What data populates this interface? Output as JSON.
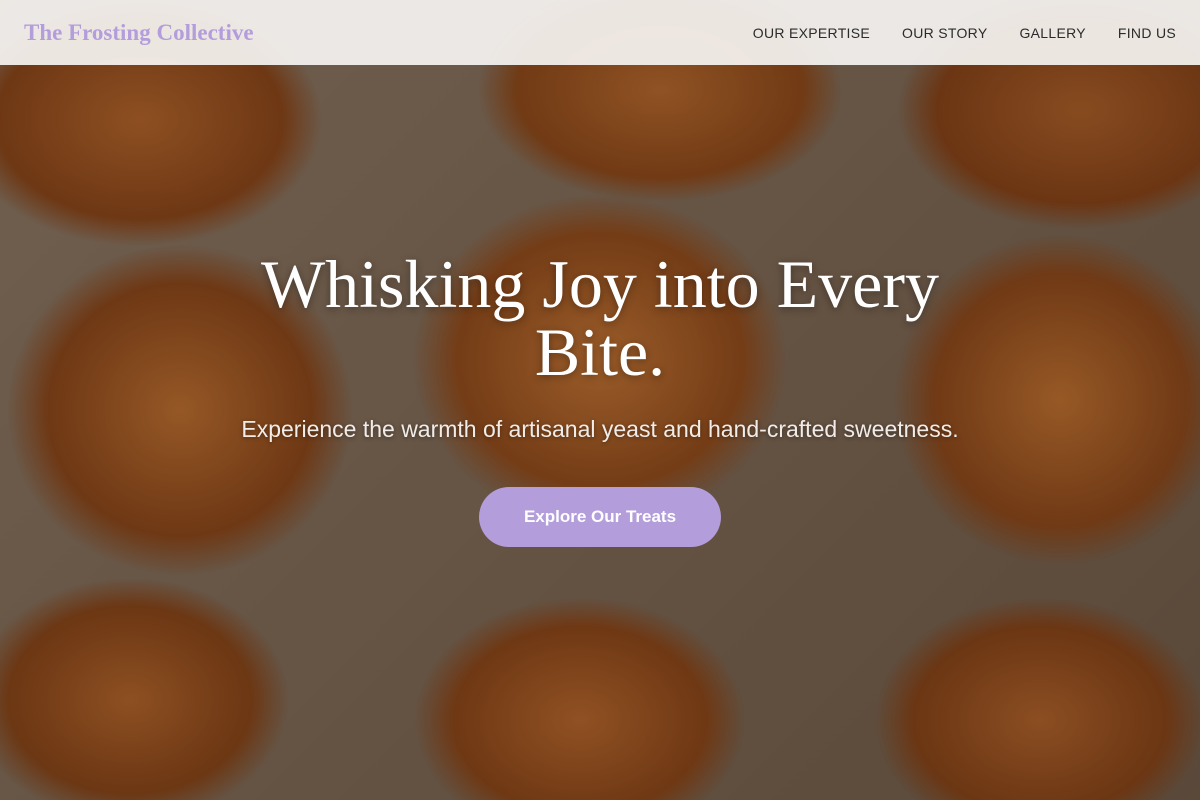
{
  "brand": {
    "name": "The Frosting Collective"
  },
  "nav": {
    "items": [
      {
        "label": "OUR EXPERTISE"
      },
      {
        "label": "OUR STORY"
      },
      {
        "label": "GALLERY"
      },
      {
        "label": "FIND US"
      }
    ]
  },
  "hero": {
    "headline": "Whisking Joy into Every Bite.",
    "subtitle": "Experience the warmth of artisanal yeast and hand-crafted sweetness.",
    "cta_label": "Explore Our Treats",
    "background": "croissants-photo"
  },
  "colors": {
    "accent": "#b39ddb",
    "nav_background": "#f5f3f1",
    "nav_text": "#2b2b2b",
    "hero_text": "#ffffff"
  }
}
